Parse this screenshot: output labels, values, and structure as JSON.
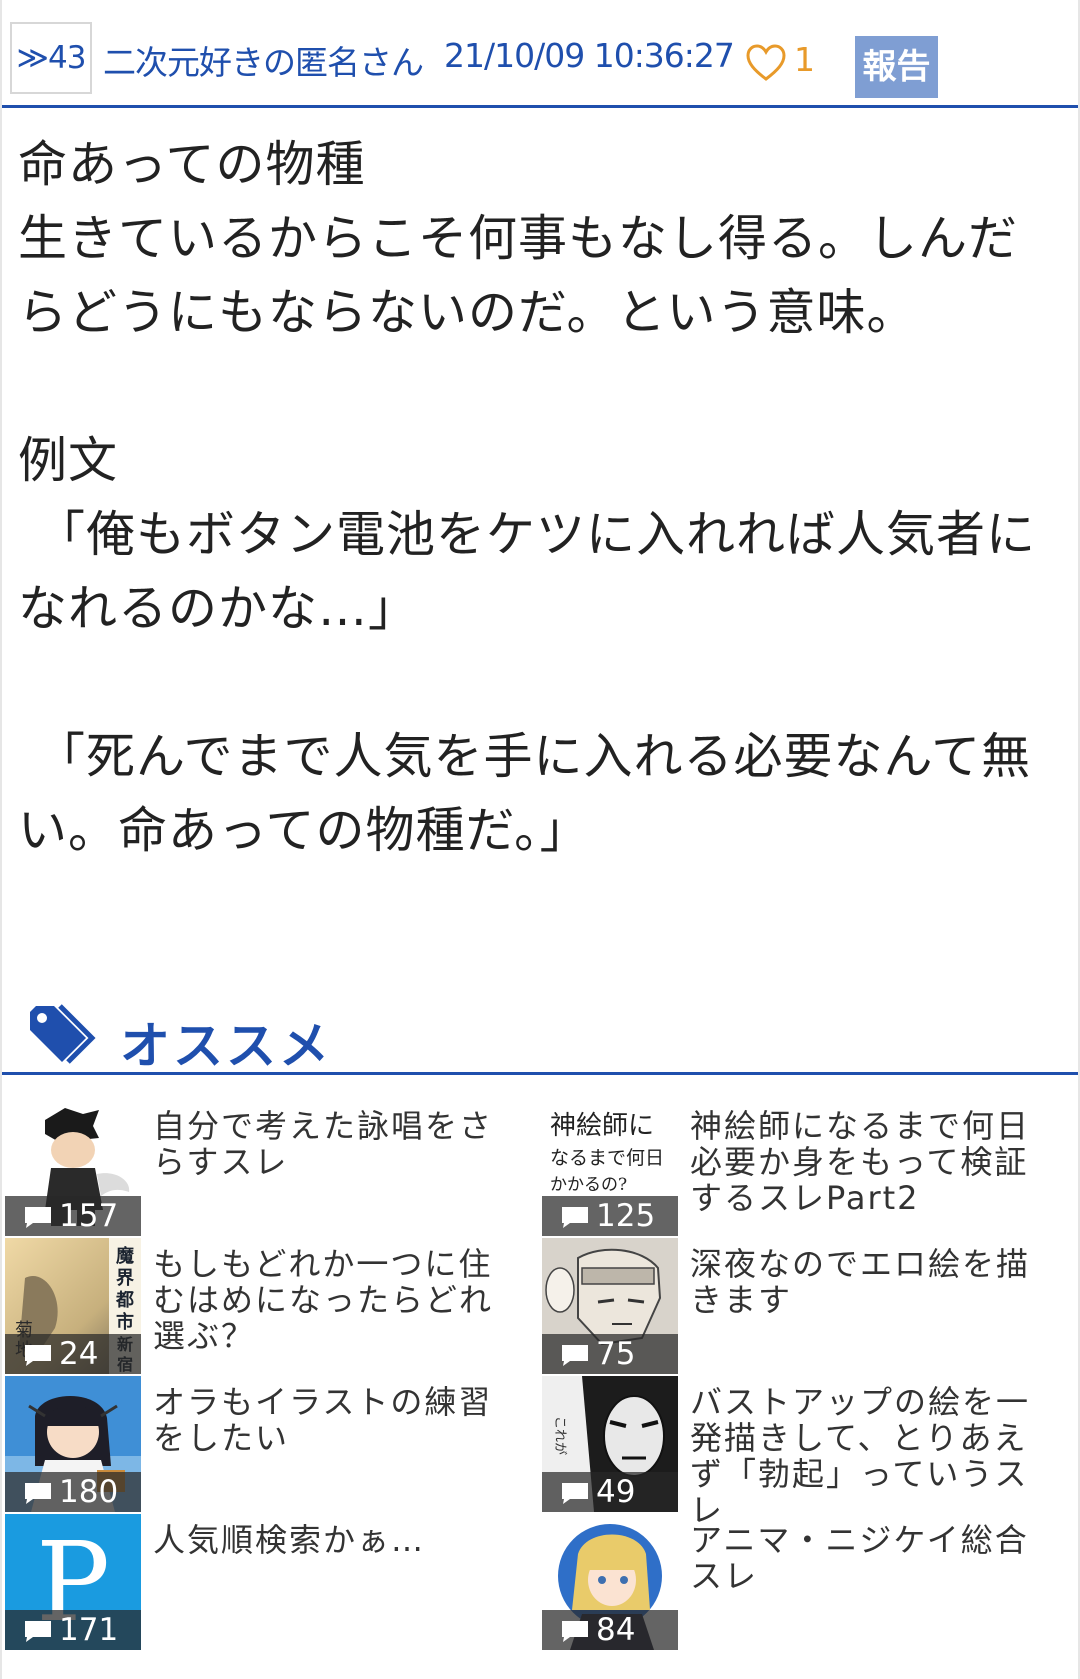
{
  "post": {
    "number": "≫43",
    "name": "二次元好きの匿名さん",
    "date": "21/10/09 10:36:27",
    "likes": "1",
    "report_label": "報告",
    "body": [
      "命あっての物種",
      "生きているからこそ何事もなし得る。しんだ",
      "らどうにもならないのだ。という意味。",
      "",
      "例文",
      "「俺もボタン電池をケツに入れれば人気者に",
      "なれるのかな…」",
      "",
      "「死んでまで人気を手に入れる必要なんて無",
      "い。命あっての物種だ。」"
    ]
  },
  "recommend": {
    "title": "オススメ",
    "items": [
      {
        "title": "自分で考えた詠唱をさらすスレ",
        "count": "157",
        "thumb": "chibi-character-thumbnail"
      },
      {
        "title": "神絵師になるまで何日必要か身をもって検証するスレPart2",
        "count": "125",
        "thumb": "handwritten-text-thumbnail",
        "thumb_text": "神絵師になるまで何日かかるの?"
      },
      {
        "title": "もしもどれか一つに住むはめになったらどれ選ぶ？",
        "count": "24",
        "thumb": "book-cover-thumbnail",
        "thumb_text": "魔界都市〈新宿〉 菊地秀行"
      },
      {
        "title": "深夜なのでエロ絵を描きます",
        "count": "75",
        "thumb": "manga-sketch-thumbnail"
      },
      {
        "title": "オラもイラストの練習をしたい",
        "count": "180",
        "thumb": "anime-girl-thumbnail"
      },
      {
        "title": "バストアップの絵を一発描きして、とりあえず「勃起」っていうスレ",
        "count": "49",
        "thumb": "manga-panel-thumbnail"
      },
      {
        "title": "人気順検索かぁ…",
        "count": "171",
        "thumb": "pixiv-logo-thumbnail",
        "thumb_text": "P"
      },
      {
        "title": "アニマ・ニジケイ総合スレ",
        "count": "84",
        "thumb": "vtuber-thumbnail"
      }
    ]
  },
  "colors": {
    "accent": "#1f4fad",
    "like": "#e89a2a",
    "report_bg": "#7f9ed3"
  }
}
